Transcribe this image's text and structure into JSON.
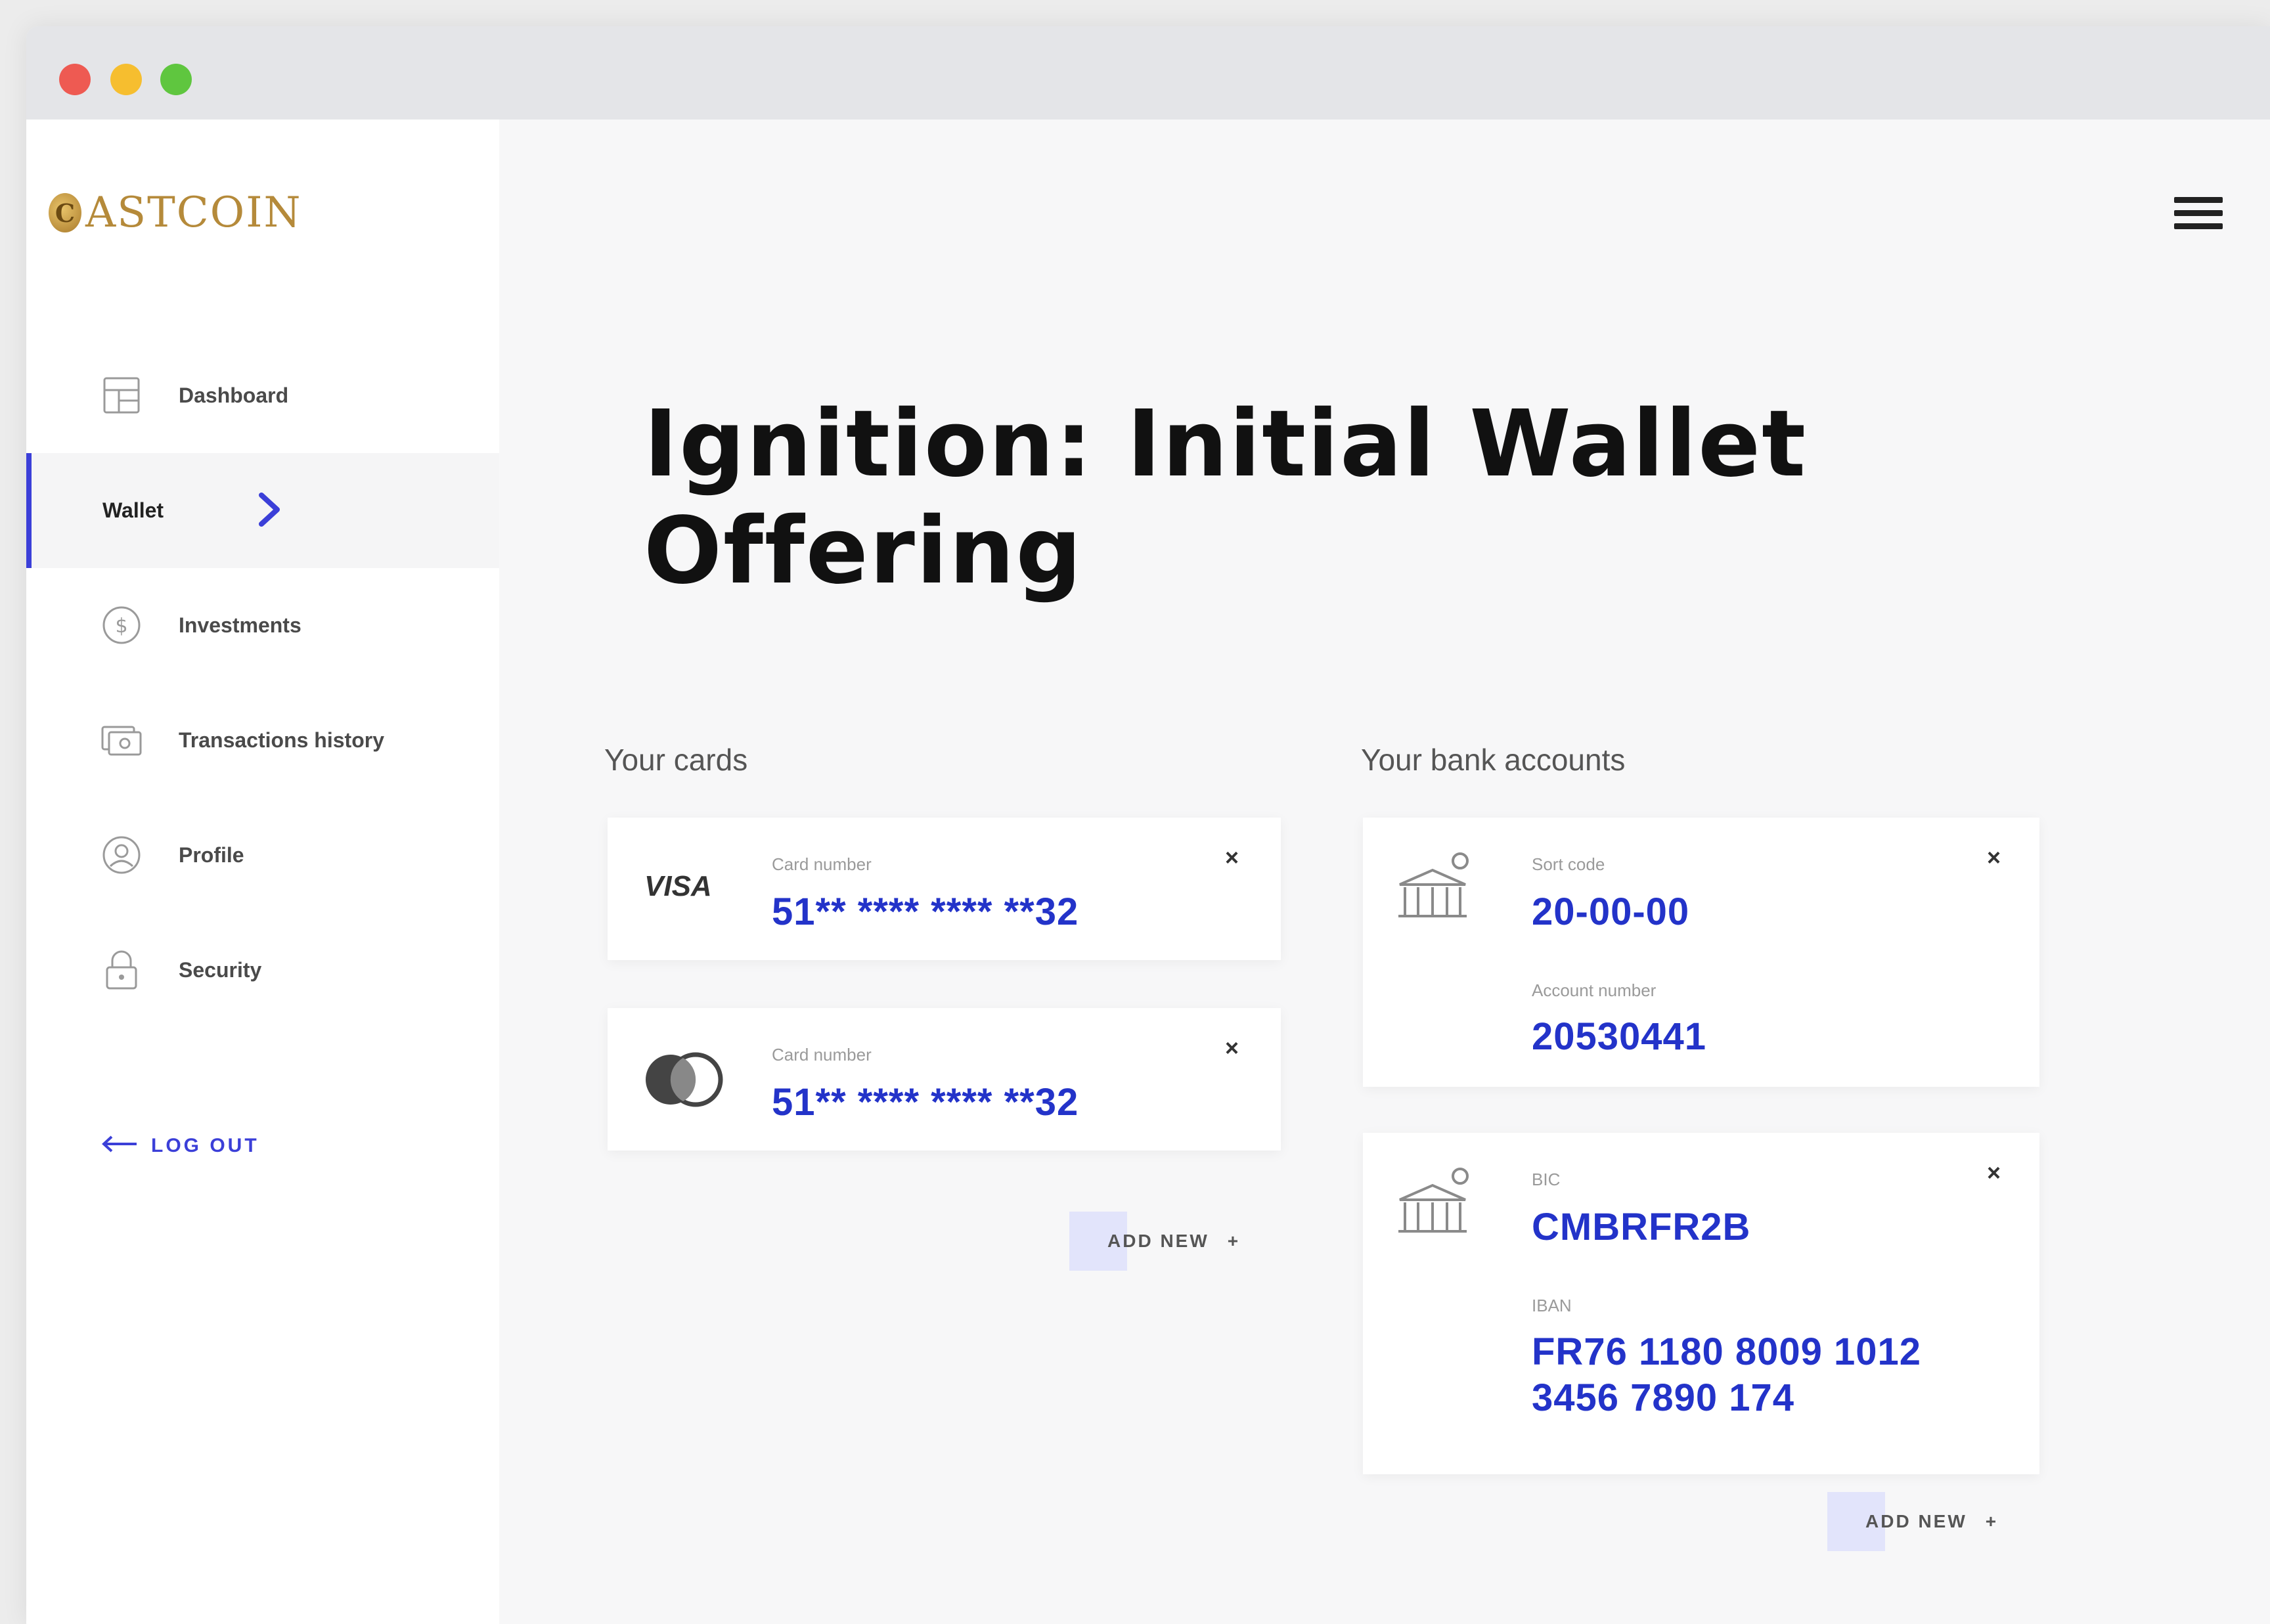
{
  "brand": {
    "logo_letter": "C",
    "logo_text": "ASTCOIN"
  },
  "sidebar": {
    "items": [
      {
        "label": "Dashboard",
        "icon": "dashboard-icon"
      },
      {
        "label": "Wallet",
        "icon": "chevron-right-icon",
        "active": true
      },
      {
        "label": "Investments",
        "icon": "dollar-icon"
      },
      {
        "label": "Transactions history",
        "icon": "transactions-icon"
      },
      {
        "label": "Profile",
        "icon": "user-icon"
      },
      {
        "label": "Security",
        "icon": "lock-icon"
      }
    ],
    "logout_label": "LOG OUT"
  },
  "main": {
    "title": "Ignition: Initial Wallet Offering",
    "cards_section": {
      "title": "Your cards",
      "cards": [
        {
          "brand": "VISA",
          "label": "Card number",
          "value": "51** **** **** **32"
        },
        {
          "brand": "mastercard",
          "label": "Card number",
          "value": "51** **** **** **32"
        }
      ],
      "add_new_label": "ADD NEW",
      "add_new_icon": "+"
    },
    "bank_section": {
      "title": "Your bank accounts",
      "accounts": [
        {
          "field1_label": "Sort code",
          "field1_value": "20-00-00",
          "field2_label": "Account number",
          "field2_value": "20530441"
        },
        {
          "field1_label": "BIC",
          "field1_value": "CMBRFR2B",
          "field2_label": "IBAN",
          "field2_value_line1": "FR76 1180 8009 1012",
          "field2_value_line2": "3456 7890 174"
        }
      ],
      "add_new_label": "ADD NEW",
      "add_new_icon": "+"
    },
    "close_symbol": "×"
  },
  "colors": {
    "accent": "#3b3fd8",
    "value_blue": "#2333c9",
    "gold": "#b58a3a"
  }
}
